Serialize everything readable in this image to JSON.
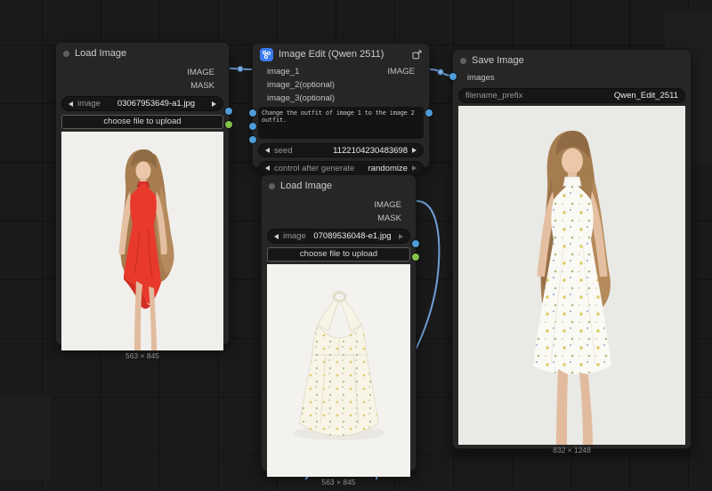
{
  "canvas": {
    "wire_color": "#6f9fd8",
    "image_port_color": "#4e9cd8",
    "mask_port_color": "#85c24c",
    "badge_color": "#3b7cf0"
  },
  "nodes": {
    "load_image_1": {
      "title": "Load Image",
      "outputs": [
        {
          "name": "IMAGE"
        },
        {
          "name": "MASK"
        }
      ],
      "image_widget": {
        "label": "image",
        "value": "03067953649-a1.jpg"
      },
      "upload_button": "choose file to upload",
      "size_label": "563 × 845"
    },
    "image_edit": {
      "title": "Image Edit (Qwen 2511)",
      "inputs": [
        {
          "name": "image_1"
        },
        {
          "name": "image_2(optional)"
        },
        {
          "name": "image_3(optional)"
        }
      ],
      "outputs": [
        {
          "name": "IMAGE"
        }
      ],
      "prompt": "Change the outfit of image 1 to the image 2 outfit.",
      "seed_widget": {
        "label": "seed",
        "value": "1122104230483698"
      },
      "control_widget": {
        "label": "control after generate",
        "value": "randomize"
      }
    },
    "load_image_2": {
      "title": "Load Image",
      "outputs": [
        {
          "name": "IMAGE"
        },
        {
          "name": "MASK"
        }
      ],
      "image_widget": {
        "label": "image",
        "value": "07089536048-e1.jpg"
      },
      "upload_button": "choose file to upload",
      "size_label": "563 × 845"
    },
    "save_image": {
      "title": "Save Image",
      "inputs": [
        {
          "name": "images"
        }
      ],
      "filename_widget": {
        "label": "filename_prefix",
        "value": "Qwen_Edit_2511"
      },
      "size_label": "832 × 1248"
    }
  }
}
